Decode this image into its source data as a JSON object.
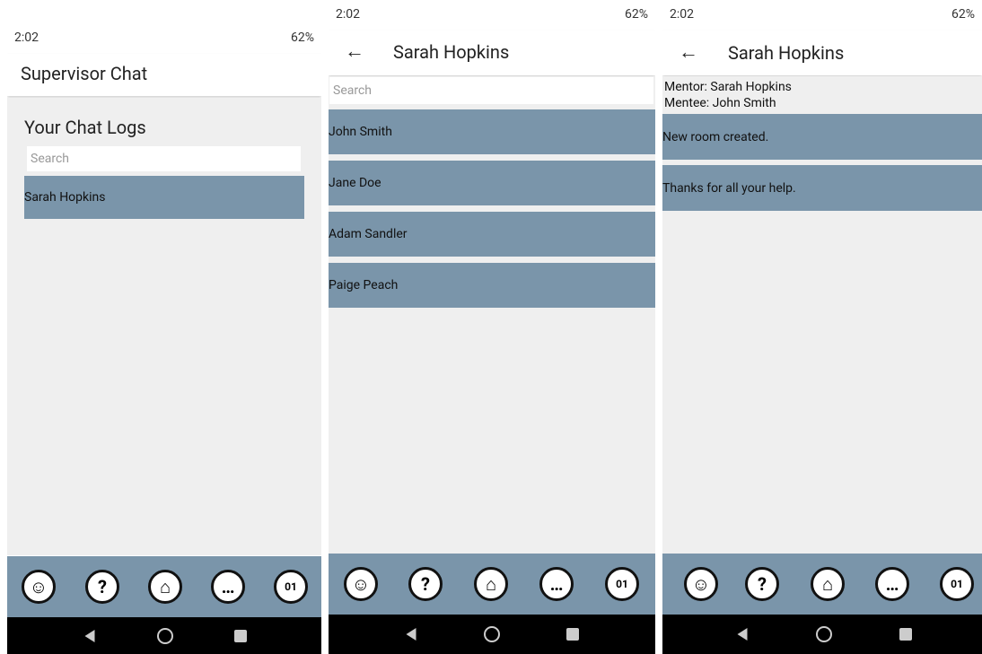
{
  "status": {
    "time": "2:02",
    "battery": "62%"
  },
  "screen1": {
    "title": "Supervisor Chat",
    "heading": "Your Chat Logs",
    "search_placeholder": "Search",
    "rows": [
      "Sarah Hopkins"
    ]
  },
  "screen2": {
    "title": "Sarah Hopkins",
    "search_placeholder": "Search",
    "rows": [
      "John Smith",
      "Jane Doe",
      "Adam Sandler",
      "Paige Peach"
    ]
  },
  "screen3": {
    "title": "Sarah Hopkins",
    "mentor": "Mentor: Sarah Hopkins",
    "mentee": "Mentee: John Smith",
    "messages": [
      "New room created.",
      "Thanks for all your help."
    ]
  },
  "nav": {
    "calendar_day": "01"
  },
  "colors": {
    "accent": "#7a95aa",
    "background": "#efefef"
  }
}
